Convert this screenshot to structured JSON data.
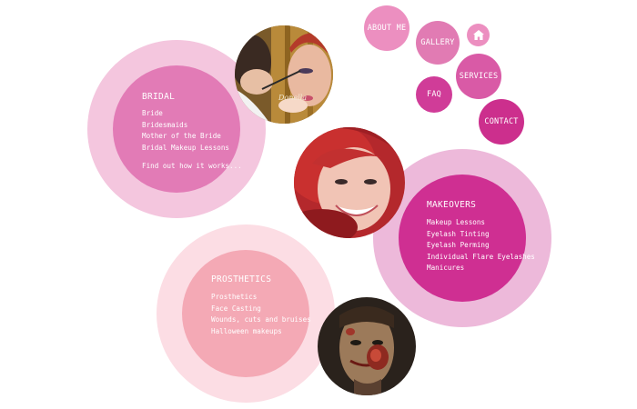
{
  "nav": {
    "about_label": "ABOUT ME",
    "gallery_label": "GALLERY",
    "services_label": "SERVICES",
    "faq_label": "FAQ",
    "contact_label": "CONTACT",
    "home_icon": "home-icon"
  },
  "bridal": {
    "title": "BRIDAL",
    "items": [
      "Bride",
      "Bridesmaids",
      "Mother of the Bride",
      "Bridal Makeup Lessons"
    ],
    "link": "Find out how it works..."
  },
  "makeovers": {
    "title": "MAKEOVERS",
    "items": [
      "Makeup Lessons",
      "Eyelash Tinting",
      "Eyelash Perming",
      "Individual Flare Eyelashes",
      "Manicures"
    ]
  },
  "prosthetics": {
    "title": "PROSTHETICS",
    "items": [
      "Prosthetics",
      "Face Casting",
      "Wounds, cuts and bruises",
      "Halloween makeups"
    ]
  },
  "photo_watermark": "Donella",
  "colors": {
    "bridal_outer": "#f4c6de",
    "bridal_inner": "#e27bb6",
    "makeovers_outer": "#edb9da",
    "makeovers_inner": "#cf2f92",
    "prosthetics_outer": "#fcdde4",
    "prosthetics_inner": "#f4a9b5"
  }
}
